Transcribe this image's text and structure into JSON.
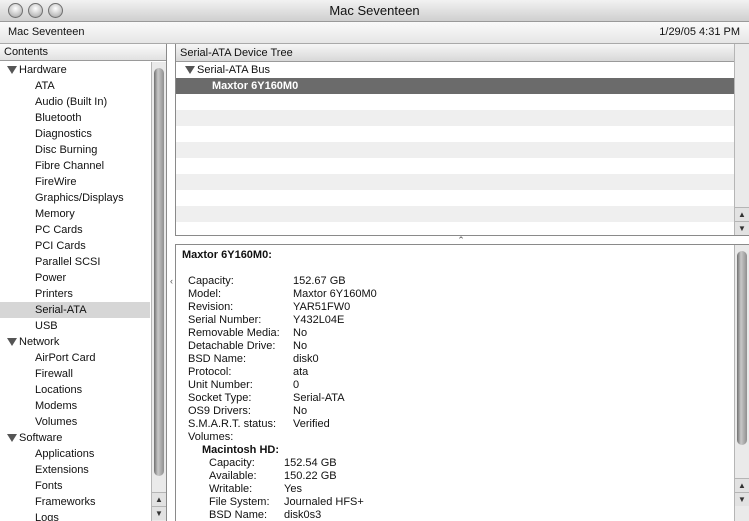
{
  "window": {
    "title": "Mac Seventeen"
  },
  "infobar": {
    "computer_name": "Mac Seventeen",
    "datetime": "1/29/05 4:31 PM"
  },
  "sidebar": {
    "header": "Contents",
    "categories": [
      {
        "label": "Hardware",
        "items": [
          "ATA",
          "Audio (Built In)",
          "Bluetooth",
          "Diagnostics",
          "Disc Burning",
          "Fibre Channel",
          "FireWire",
          "Graphics/Displays",
          "Memory",
          "PC Cards",
          "PCI Cards",
          "Parallel SCSI",
          "Power",
          "Printers",
          "Serial-ATA",
          "USB"
        ]
      },
      {
        "label": "Network",
        "items": [
          "AirPort Card",
          "Firewall",
          "Locations",
          "Modems",
          "Volumes"
        ]
      },
      {
        "label": "Software",
        "items": [
          "Applications",
          "Extensions",
          "Fonts",
          "Frameworks",
          "Logs"
        ]
      }
    ],
    "selected_item": "Serial-ATA"
  },
  "device_tree": {
    "header": "Serial-ATA Device Tree",
    "bus": "Serial-ATA Bus",
    "device": "Maxtor 6Y160M0"
  },
  "detail": {
    "title": "Maxtor 6Y160M0:",
    "properties": [
      {
        "label": "Capacity:",
        "value": "152.67 GB"
      },
      {
        "label": "Model:",
        "value": "Maxtor 6Y160M0"
      },
      {
        "label": "Revision:",
        "value": "YAR51FW0"
      },
      {
        "label": "Serial Number:",
        "value": "Y432L04E"
      },
      {
        "label": "Removable Media:",
        "value": "No"
      },
      {
        "label": "Detachable Drive:",
        "value": "No"
      },
      {
        "label": "BSD Name:",
        "value": "disk0"
      },
      {
        "label": "Protocol:",
        "value": "ata"
      },
      {
        "label": "Unit Number:",
        "value": "0"
      },
      {
        "label": "Socket Type:",
        "value": "Serial-ATA"
      },
      {
        "label": "OS9 Drivers:",
        "value": "No"
      },
      {
        "label": "S.M.A.R.T. status:",
        "value": "Verified"
      },
      {
        "label": "Volumes:",
        "value": ""
      }
    ],
    "volume": {
      "name": "Macintosh HD:",
      "properties": [
        {
          "label": "Capacity:",
          "value": "152.54 GB"
        },
        {
          "label": "Available:",
          "value": "150.22 GB"
        },
        {
          "label": "Writable:",
          "value": "Yes"
        },
        {
          "label": "File System:",
          "value": "Journaled HFS+"
        },
        {
          "label": "BSD Name:",
          "value": "disk0s3"
        }
      ]
    }
  }
}
